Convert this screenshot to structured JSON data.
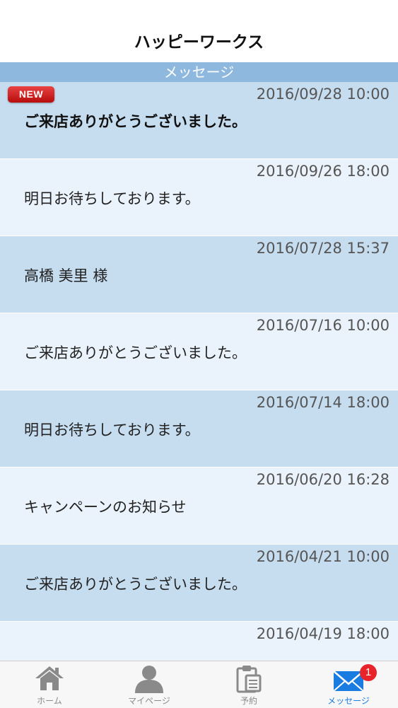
{
  "header": {
    "title": "ハッピーワークス"
  },
  "section": {
    "title": "メッセージ"
  },
  "badge_new": "NEW",
  "messages": [
    {
      "date": "2016/09/28 10:00",
      "text": "ご来店ありがとうございました。",
      "unread": true
    },
    {
      "date": "2016/09/26 18:00",
      "text": "明日お待ちしております。"
    },
    {
      "date": "2016/07/28 15:37",
      "text": "高橋 美里 様"
    },
    {
      "date": "2016/07/16 10:00",
      "text": "ご来店ありがとうございました。"
    },
    {
      "date": "2016/07/14 18:00",
      "text": "明日お待ちしております。"
    },
    {
      "date": "2016/06/20 16:28",
      "text": "キャンペーンのお知らせ"
    },
    {
      "date": "2016/04/21 10:00",
      "text": "ご来店ありがとうございました。"
    },
    {
      "date": "2016/04/19 18:00",
      "text": ""
    }
  ],
  "tabbar": {
    "tabs": [
      {
        "label": "ホーム",
        "icon": "home-icon"
      },
      {
        "label": "マイページ",
        "icon": "person-icon"
      },
      {
        "label": "予約",
        "icon": "clipboard-icon"
      },
      {
        "label": "メッセージ",
        "icon": "mail-icon",
        "active": true,
        "badge": "1"
      }
    ]
  },
  "colors": {
    "section_bar": "#8fb8df",
    "row_dark": "#c6dcef",
    "row_light": "#eaf2fb",
    "active_tab": "#1a7be0",
    "badge": "#e8242b"
  }
}
